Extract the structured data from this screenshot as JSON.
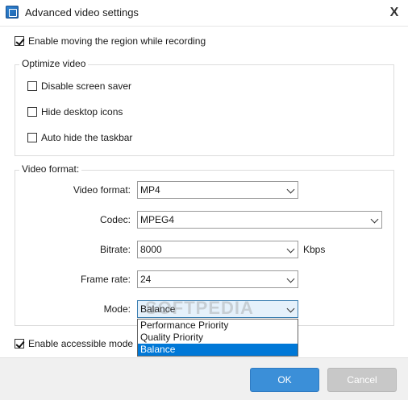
{
  "window": {
    "title": "Advanced video settings",
    "close_symbol": "X"
  },
  "top_options": {
    "enable_moving": {
      "label": "Enable moving the region while recording",
      "checked": true
    }
  },
  "optimize_video": {
    "title": "Optimize video",
    "options": [
      {
        "label": "Disable screen saver",
        "checked": false
      },
      {
        "label": "Hide desktop icons",
        "checked": false
      },
      {
        "label": "Auto hide the taskbar",
        "checked": false
      }
    ]
  },
  "video_format": {
    "title": "Video format:",
    "fields": {
      "format": {
        "label": "Video format:",
        "value": "MP4"
      },
      "codec": {
        "label": "Codec:",
        "value": "MPEG4"
      },
      "bitrate": {
        "label": "Bitrate:",
        "value": "8000",
        "unit": "Kbps"
      },
      "frame_rate": {
        "label": "Frame rate:",
        "value": "24"
      },
      "mode": {
        "label": "Mode:",
        "value": "Balance"
      }
    },
    "mode_options": [
      "Performance Priority",
      "Quality Priority",
      "Balance"
    ]
  },
  "bottom_options": {
    "accessible_mode": {
      "label": "Enable accessible mode",
      "checked": true
    }
  },
  "watermark": "SOFTPEDIA",
  "buttons": {
    "ok": "OK",
    "cancel": "Cancel"
  },
  "colors": {
    "ok_bg": "#3b8fd8",
    "cancel_bg": "#c8c8c8",
    "selected_item_bg": "#0078d7"
  }
}
